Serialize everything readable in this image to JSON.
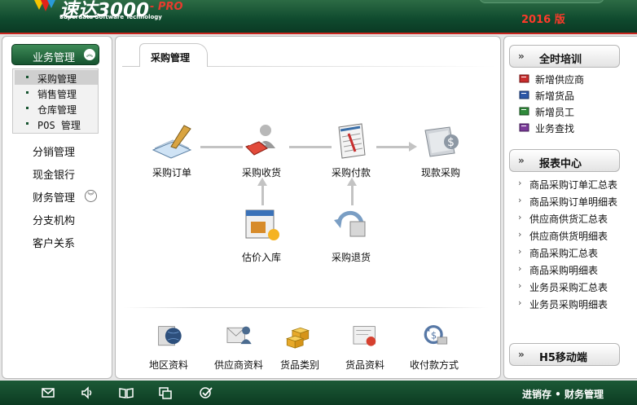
{
  "header": {
    "title": "速达3000",
    "pro": "- PRO",
    "subtitle": "Superdata Software Technology",
    "edition": "2016 版"
  },
  "sidebar": {
    "business_button": "业务管理",
    "submenu": [
      "采购管理",
      "销售管理",
      "仓库管理",
      "POS 管理"
    ],
    "items": [
      "分销管理",
      "现金银行",
      "财务管理",
      "分支机构",
      "客户关系"
    ]
  },
  "main": {
    "tab": "采购管理",
    "flow": {
      "order": "采购订单",
      "receive": "采购收货",
      "pay": "采购付款",
      "cash": "现款采购",
      "estimate": "估价入库",
      "return": "采购退货"
    },
    "bottom": [
      "地区资料",
      "供应商资料",
      "货品类别",
      "货品资料",
      "收付款方式"
    ]
  },
  "right": {
    "training_header": "全时培训",
    "training_items": [
      "新增供应商",
      "新增货品",
      "新增员工",
      "业务查找"
    ],
    "report_header": "报表中心",
    "report_items": [
      "商品采购订单汇总表",
      "商品采购订单明细表",
      "供应商供货汇总表",
      "供应商供货明细表",
      "商品采购汇总表",
      "商品采购明细表",
      "业务员采购汇总表",
      "业务员采购明细表"
    ],
    "mobile_header": "H5移动端"
  },
  "footer": {
    "text": "进销存 • 财务管理",
    "icons": [
      "mail-icon",
      "speaker-icon",
      "book-icon",
      "windows-icon",
      "check-icon"
    ]
  },
  "colors": {
    "header_green": "#0f4a2e",
    "accent_red": "#c9261f",
    "edition_red": "#ff3a2a"
  }
}
